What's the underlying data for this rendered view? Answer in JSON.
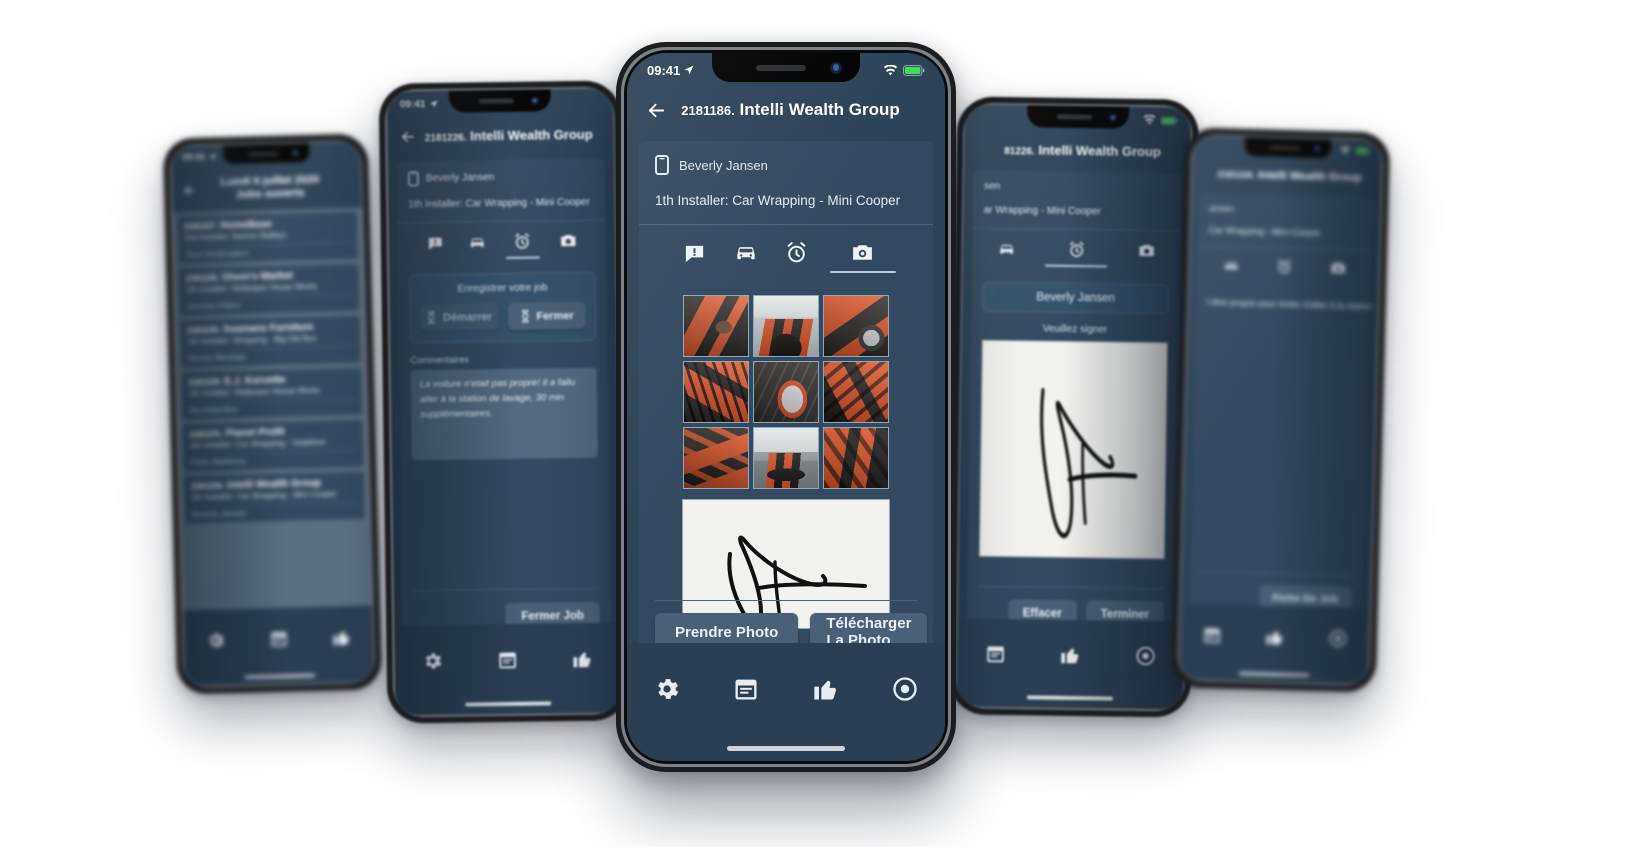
{
  "colors": {
    "app_background": "#2c4257",
    "card": "#33495f",
    "navbar": "#2c4257",
    "accent_underline": "#b8cde0",
    "button": "#4a6076",
    "bottom_nav": "#2b3f54",
    "signature_pad": "#f2f2f0",
    "wrap_orange": "#e2562a",
    "wrap_dark": "#2a2724"
  },
  "status_bar": {
    "time": "09:41",
    "location_icon": "location-arrow-icon",
    "wifi_icon": "wifi-icon",
    "battery_icon": "battery-icon"
  },
  "phones": [
    {
      "id": "phone-job-list",
      "screen": "job-list",
      "navbar": {
        "back_icon": "back-arrow-icon",
        "title_line1": "Lundi 6 juillet 2020",
        "title_line2": "Jobs ouverts"
      },
      "jobs": [
        {
          "number": "2181227.",
          "name": "HomeBase",
          "installer": "2nd Installer: Banner Batleys",
          "contact": "Teun Hooijmaijers"
        },
        {
          "number": "2181228.",
          "name": "Olson's Market",
          "installer": "1th Installer: Wallpaper House Works",
          "contact": "Jasmine Fitters"
        },
        {
          "number": "2181230.",
          "name": "Seamans Furniture",
          "installer": "1th Installer: Wrapping - Big Old Bus",
          "contact": "Nienke Bleshaar"
        },
        {
          "number": "2181229.",
          "name": "E.J. Korvette",
          "installer": "1th Installer: Wallpaper House Works",
          "contact": "Mechteld Bon"
        },
        {
          "number": "2181231.",
          "name": "Planet Profit",
          "installer": "1th Installer: Car Wrapping - Vodafone",
          "contact": "Pieke Bekkema"
        },
        {
          "number": "2181226.",
          "name": "Intelli Wealth Group",
          "installer": "1th Installer: Car Wrapping - Mini Cooper",
          "contact": "Beverly Jansen"
        }
      ],
      "bottom_nav": [
        "gear-icon",
        "calendar-icon",
        "thumbs-up-icon"
      ]
    },
    {
      "id": "phone-close-job",
      "screen": "time-registration",
      "navbar": {
        "back_icon": "back-arrow-icon",
        "title_number": "2181226.",
        "title_name": "Intelli Wealth Group"
      },
      "contact": {
        "icon": "phone-icon",
        "name": "Beverly Jansen"
      },
      "installer": "1th Installer: Car Wrapping - Mini Cooper",
      "tabs": [
        {
          "icon": "alert-message-icon",
          "active": false
        },
        {
          "icon": "car-icon",
          "active": false
        },
        {
          "icon": "alarm-clock-icon",
          "active": true
        },
        {
          "icon": "camera-icon",
          "active": false
        }
      ],
      "panel_title": "Enregistrer votre job",
      "timer_buttons": [
        {
          "icon": "hourglass-icon",
          "label": "Démarrer",
          "disabled": true
        },
        {
          "icon": "hourglass-icon",
          "label": "Fermer",
          "disabled": false
        }
      ],
      "comments_label": "Commentaires",
      "comments_value": "La voiture n'etait pas propre! Il a fallu aller à la station de lavage, 30 min supplémentaires.",
      "primary_button": "Fermer Job",
      "bottom_nav": [
        "gear-icon",
        "calendar-icon",
        "thumbs-up-icon"
      ]
    },
    {
      "id": "phone-photos",
      "screen": "photos-and-signature",
      "navbar": {
        "back_icon": "back-arrow-icon",
        "title_number": "2181186.",
        "title_name": "Intelli Wealth Group"
      },
      "contact": {
        "icon": "phone-icon",
        "name": "Beverly Jansen"
      },
      "installer": "1th Installer: Car Wrapping - Mini Cooper",
      "tabs": [
        {
          "icon": "alert-message-icon",
          "active": false
        },
        {
          "icon": "car-icon",
          "active": false
        },
        {
          "icon": "alarm-clock-icon",
          "active": false
        },
        {
          "icon": "camera-icon",
          "active": true
        }
      ],
      "photos": [
        "wrapped-mini-side-mirror",
        "wrapped-mini-front",
        "wrapped-mini-wheel-arch",
        "wrapped-mini-grille",
        "wrapped-mini-door-handle",
        "wrapped-mini-rear-quarter",
        "wrapped-mini-bumper",
        "wrapped-mini-showroom",
        "wrapped-mini-hood"
      ],
      "signature_present": true,
      "buttons": [
        "Prendre Photo",
        "Télécharger La Photo"
      ],
      "bottom_nav": [
        "gear-icon",
        "calendar-icon",
        "thumbs-up-icon",
        "record-icon"
      ]
    },
    {
      "id": "phone-signature",
      "screen": "signature",
      "navbar": {
        "title_number": "81226.",
        "title_name": "Intelli Wealth Group"
      },
      "contact_fragment": "sen",
      "installer_fragment": "ar Wrapping - Mini Cooper",
      "tabs": [
        {
          "icon": "car-icon",
          "active": false
        },
        {
          "icon": "alarm-clock-icon",
          "active": true
        },
        {
          "icon": "camera-icon",
          "active": false
        }
      ],
      "signer_name": "Beverly Jansen",
      "sign_prompt": "Veuillez signer",
      "buttons": [
        "Effacer",
        "Terminer"
      ],
      "bottom_nav": [
        "calendar-icon",
        "thumbs-up-icon",
        "record-icon"
      ]
    },
    {
      "id": "phone-job-sheet",
      "screen": "job-sheet",
      "navbar": {
        "title_number": "2181226.",
        "title_name": "Intelli Wealth Group"
      },
      "contact_fragment": "ansen",
      "installer_fragment": "Car Wrapping - Mini Cooper",
      "tabs": [
        {
          "icon": "car-icon",
          "active": false
        },
        {
          "icon": "alarm-clock-icon",
          "active": false
        },
        {
          "icon": "camera-icon",
          "active": false
        }
      ],
      "note_fragment": "t être propre pour éviter d'aller à la station",
      "primary_button": "Fiche De Job",
      "bottom_nav": [
        "calendar-icon",
        "thumbs-up-icon",
        "record-icon"
      ]
    }
  ]
}
